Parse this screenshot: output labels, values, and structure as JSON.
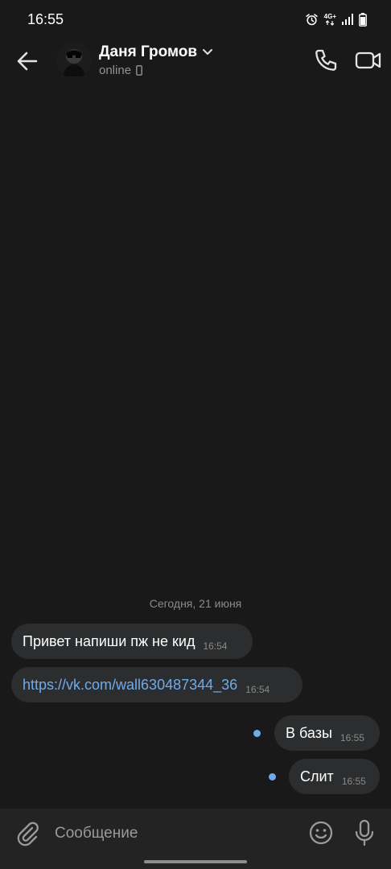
{
  "status_bar": {
    "time": "16:55",
    "network_label": "4G+",
    "icons": [
      "alarm-icon",
      "network-4g-icon",
      "signal-icon",
      "battery-icon"
    ]
  },
  "header": {
    "back_icon": "arrow-left-icon",
    "contact_name": "Даня Громов",
    "status": "online",
    "status_device_icon": "phone-device-icon",
    "call_icon": "phone-icon",
    "video_icon": "video-camera-icon"
  },
  "chat": {
    "date_separator": "Сегодня, 21 июня",
    "messages": [
      {
        "direction": "incoming",
        "text": "Привет напиши пж не кид",
        "time": "16:54",
        "is_link": false
      },
      {
        "direction": "incoming",
        "text": "https://vk.com/wall630487344_36",
        "time": "16:54",
        "is_link": true
      },
      {
        "direction": "outgoing",
        "text": "В базы",
        "time": "16:55",
        "unread": true
      },
      {
        "direction": "outgoing",
        "text": "Слит",
        "time": "16:55",
        "unread": true
      }
    ]
  },
  "composer": {
    "placeholder": "Сообщение",
    "attach_icon": "paperclip-icon",
    "emoji_icon": "smiley-icon",
    "mic_icon": "microphone-icon"
  },
  "colors": {
    "background": "#19191a",
    "bubble": "#2c2d2e",
    "accent": "#71aaeb",
    "composer": "#232324"
  }
}
